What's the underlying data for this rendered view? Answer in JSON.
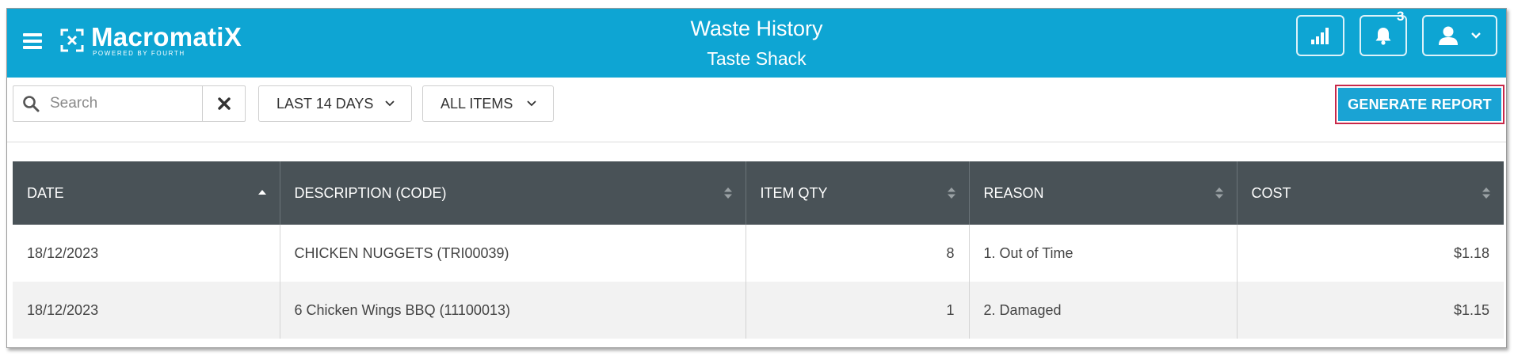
{
  "header": {
    "brand_name": "MacromatiX",
    "brand_tagline": "POWERED BY FOURTH",
    "title": "Waste History",
    "subtitle": "Taste Shack",
    "notification_count": "3",
    "bg_color": "#0ea5d3"
  },
  "filters": {
    "search_placeholder": "Search",
    "search_value": "",
    "date_range": "LAST 14 DAYS",
    "item_filter": "ALL ITEMS",
    "generate_label": "GENERATE REPORT"
  },
  "table": {
    "columns": [
      "DATE",
      "DESCRIPTION (CODE)",
      "ITEM QTY",
      "REASON",
      "COST"
    ],
    "sorted_column": "DATE",
    "sort_direction": "ascending",
    "rows": [
      {
        "date": "18/12/2023",
        "description": "CHICKEN NUGGETS (TRI00039)",
        "qty": "8",
        "reason": "1. Out of Time",
        "cost": "$1.18"
      },
      {
        "date": "18/12/2023",
        "description": "6 Chicken Wings BBQ (11100013)",
        "qty": "1",
        "reason": "2. Damaged",
        "cost": "$1.15"
      }
    ]
  },
  "icons": {
    "menu": "hamburger-icon",
    "reports": "bar-chart-icon",
    "notifications": "bell-icon",
    "user": "user-icon",
    "user_dropdown": "chevron-down-icon",
    "search": "search-icon",
    "clear": "close-icon"
  }
}
